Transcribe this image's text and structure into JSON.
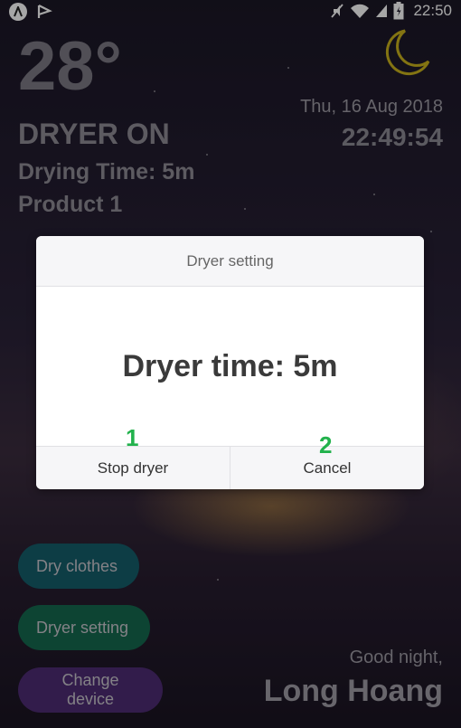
{
  "status_bar": {
    "time": "22:50",
    "left_icons": [
      "app-notification-icon",
      "flag-notification-icon"
    ],
    "right_icons": [
      "mute-icon",
      "wifi-icon",
      "signal-icon",
      "battery-icon"
    ]
  },
  "weather": {
    "temperature": "28°",
    "condition_icon": "moon-icon",
    "date": "Thu, 16 Aug 2018",
    "clock": "22:49:54"
  },
  "dryer": {
    "status": "DRYER ON",
    "drying_time": "Drying Time: 5m",
    "product": "Product 1"
  },
  "actions": {
    "dry_clothes": "Dry clothes",
    "dryer_setting": "Dryer setting",
    "change_device": "Change device"
  },
  "greeting": {
    "text": "Good night,",
    "name": "Long Hoang"
  },
  "dialog": {
    "title": "Dryer setting",
    "message": "Dryer time: 5m",
    "stop_label": "Stop dryer",
    "cancel_label": "Cancel"
  },
  "annotations": {
    "one": "1",
    "two": "2"
  },
  "colors": {
    "dry_clothes_button": "#155e6b",
    "dryer_setting_button": "#15694f",
    "change_device_button": "#4e2b73",
    "annotation": "#22b24c",
    "moon": "#c9b21c"
  }
}
